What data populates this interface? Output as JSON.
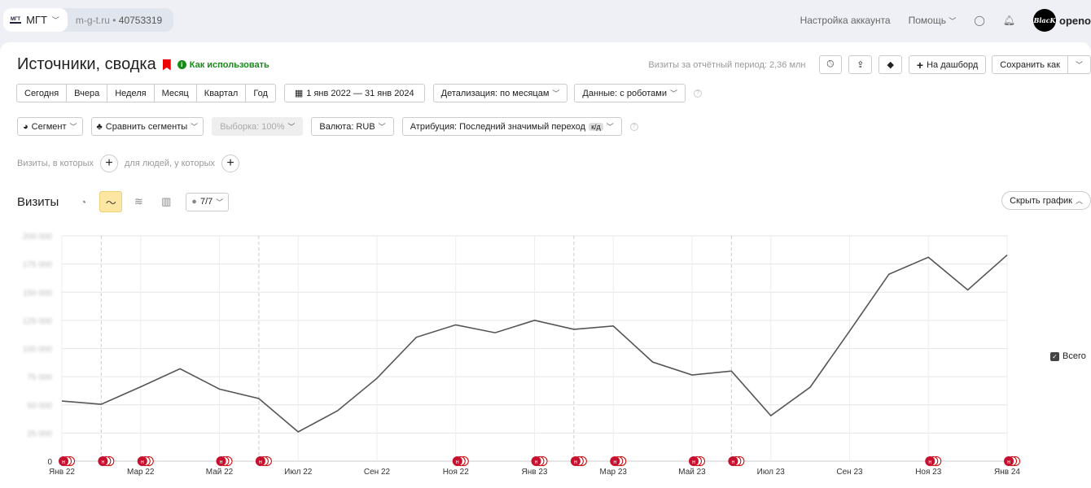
{
  "top": {
    "site_name": "МГТ",
    "logo_text": "МГТ",
    "domain": "m-g-t.ru",
    "counter_id": "40753319",
    "account_settings": "Настройка аккаунта",
    "help": "Помощь",
    "avatar_text": "BlacK",
    "user": "openo"
  },
  "header": {
    "title": "Источники, сводка",
    "how_to_use": "Как использовать",
    "visits_total": "Визиты за отчётный период: 2,36 млн",
    "dashboard": "На дашборд",
    "save_as": "Сохранить как"
  },
  "periods": [
    "Сегодня",
    "Вчера",
    "Неделя",
    "Месяц",
    "Квартал",
    "Год"
  ],
  "date_range": "1 янв 2022 — 31 янв 2024",
  "detail": "Детализация: по месяцам",
  "data_mode": "Данные: с роботами",
  "segment": "Сегмент",
  "compare": "Сравнить сегменты",
  "sample": "Выборка: 100%",
  "currency": "Валюта: RUB",
  "attribution": "Атрибуция: Последний значимый переход",
  "attribution_badge": "к/д",
  "filters": {
    "visits_where": "Визиты, в которых",
    "people_where": "для людей, у которых"
  },
  "chart_header": {
    "title": "Визиты",
    "series_count": "7/7",
    "hide": "Скрыть график"
  },
  "chart_data": {
    "type": "line",
    "title": "Визиты",
    "ylim": [
      0,
      200000
    ],
    "yticks": [
      "0",
      "25 000",
      "50 000",
      "75 000",
      "100 000",
      "125 000",
      "150 000",
      "175 000",
      "200 000"
    ],
    "xticks": [
      "Янв 22",
      "Мар 22",
      "Май 22",
      "Июл 22",
      "Сен 22",
      "Ноя 22",
      "Янв 23",
      "Мар 23",
      "Май 23",
      "Июл 23",
      "Сен 23",
      "Ноя 23",
      "Янв 24"
    ],
    "series": [
      {
        "name": "Всего",
        "color": "#555555",
        "values": [
          53400,
          50500,
          66000,
          82000,
          64000,
          55600,
          26000,
          44800,
          73600,
          110000,
          121000,
          114000,
          125000,
          117000,
          120000,
          88000,
          76500,
          80000,
          40400,
          65700,
          115500,
          166000,
          181000,
          152000,
          183000
        ]
      }
    ],
    "annotation_months": [
      0,
      1,
      2,
      4,
      5,
      10,
      12,
      13,
      14,
      16,
      17,
      22,
      24
    ],
    "legend": "top-right"
  },
  "marker_letter": "н"
}
